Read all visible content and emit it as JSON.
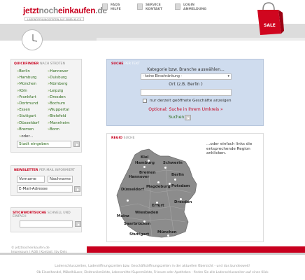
{
  "header": {
    "logo_part1": "jetzt",
    "logo_part2": "noch",
    "logo_part3": "einkaufen",
    "logo_part4": ".de",
    "logo_sub": "LADENÖFFNUNGSZEITEN AUF EINEN KLICK",
    "links": [
      {
        "line1": "FAQS",
        "line2": "HILFE"
      },
      {
        "line1": "SERVICE",
        "line2": "KONTAKT"
      },
      {
        "line1": "LOGIN",
        "line2": "ANMELDUNG"
      }
    ],
    "bag_text": "SALE"
  },
  "quickfinder": {
    "title_red": "QUICKFINDER",
    "title_gray": "NACH STÄDTEN",
    "col1": [
      "Berlin",
      "Hamburg",
      "München",
      "Köln",
      "Frankfurt",
      "Dortmund",
      "Essen",
      "Stuttgart",
      "Düsseldorf",
      "Bremen"
    ],
    "col2": [
      "Hannover",
      "Duisburg",
      "Nürnberg",
      "Leipzig",
      "Dresden",
      "Bochum",
      "Wuppertal",
      "Bielefeld",
      "Mannheim",
      "Bonn"
    ],
    "oder": "oder...",
    "city_input_label": "Stadt eingeben"
  },
  "newsletter": {
    "title_red": "NEWSLETTER",
    "title_gray": "PER MAIL INFORMIERT",
    "vorname": "Vorname",
    "nachname": "Nachname",
    "email": "E-Mail-Adresse"
  },
  "stichwort": {
    "title_red": "STICHWORTSUCHE",
    "title_gray": "SCHNELL UND EINFACH"
  },
  "suche": {
    "title_red": "SUCHE",
    "title_gray": "PER TEXT",
    "kategorie_label": "Kategorie bzw. Branche auswählen...",
    "select_value": "- keine Einschränkung -",
    "ort_label": "Ort (z.B. Berlin )",
    "checkbox_label": "nur derzeit geöffnete Geschäfte anzeigen",
    "optional": "Optional: Suche in Ihrem Umkreis »",
    "suchen": "Suchen"
  },
  "regio": {
    "title_red": "REGIO",
    "title_gray": "SUCHE",
    "hint": "...oder einfach links die entsprechende Region anklicken.",
    "cities": [
      "Kiel",
      "Hamburg",
      "Schwerin",
      "Bremen",
      "Hannover",
      "Berlin",
      "Potsdam",
      "Düsseldorf",
      "Magdeburg",
      "Dresden",
      "Erfurt",
      "Wiesbaden",
      "Mainz",
      "Saarbrücken",
      "Stuttgart",
      "München"
    ]
  },
  "left_footer": {
    "line1": "© jetztnocheinkaufen.de",
    "line2": "Impressum | AGB | Kontakt | by Dels"
  },
  "footer": {
    "line1": "Ladenschlusszeiten, Ladenöffnungszeiten bzw. Geschäftsöffnungszeiten in der aktuellen Übersicht - und das bundesweit!",
    "line2": "Ob Einzelhandel, Möbelhäuser, Elektronikmärkte, Lebensmittel-Supermärkte, Friseure oder Apotheken - finden Sie alle Ladenschlusszeiten auf einen Klick"
  }
}
